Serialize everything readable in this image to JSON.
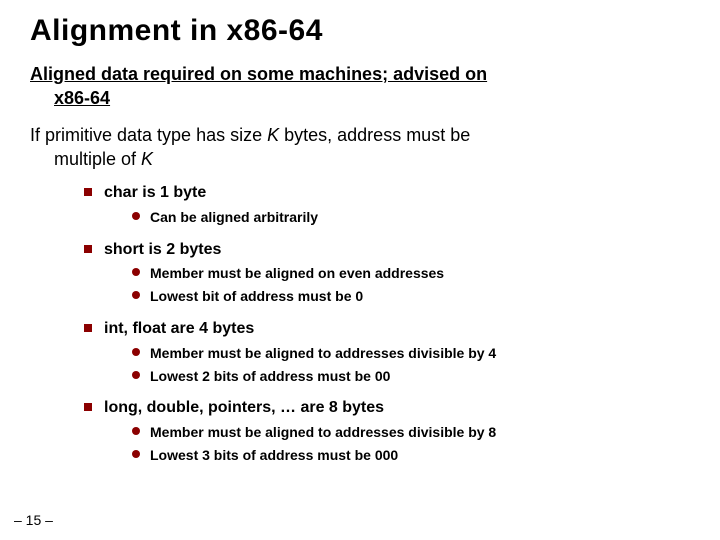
{
  "title": "Alignment in x86-64",
  "section1_line1": "Aligned data required on some machines; advised on",
  "section1_line2": "x86-64",
  "section2_pre": "If primitive data type has size ",
  "section2_k": "K",
  "section2_mid": " bytes, address must be",
  "section2_line2_pre": "multiple of ",
  "section2_line2_k": "K",
  "bullets": {
    "b1": "char is 1 byte",
    "b1_s1": "Can be aligned arbitrarily",
    "b2": "short is 2 bytes",
    "b2_s1": "Member must be aligned on even addresses",
    "b2_s2": "Lowest bit of address must be 0",
    "b3": "int, float are 4 bytes",
    "b3_s1": "Member must be aligned to addresses divisible by 4",
    "b3_s2": "Lowest 2 bits of address must be 00",
    "b4": "long, double, pointers, … are 8 bytes",
    "b4_s1": "Member must be aligned to addresses divisible by 8",
    "b4_s2": "Lowest 3 bits of address must be 000"
  },
  "page_number": "– 15 –"
}
